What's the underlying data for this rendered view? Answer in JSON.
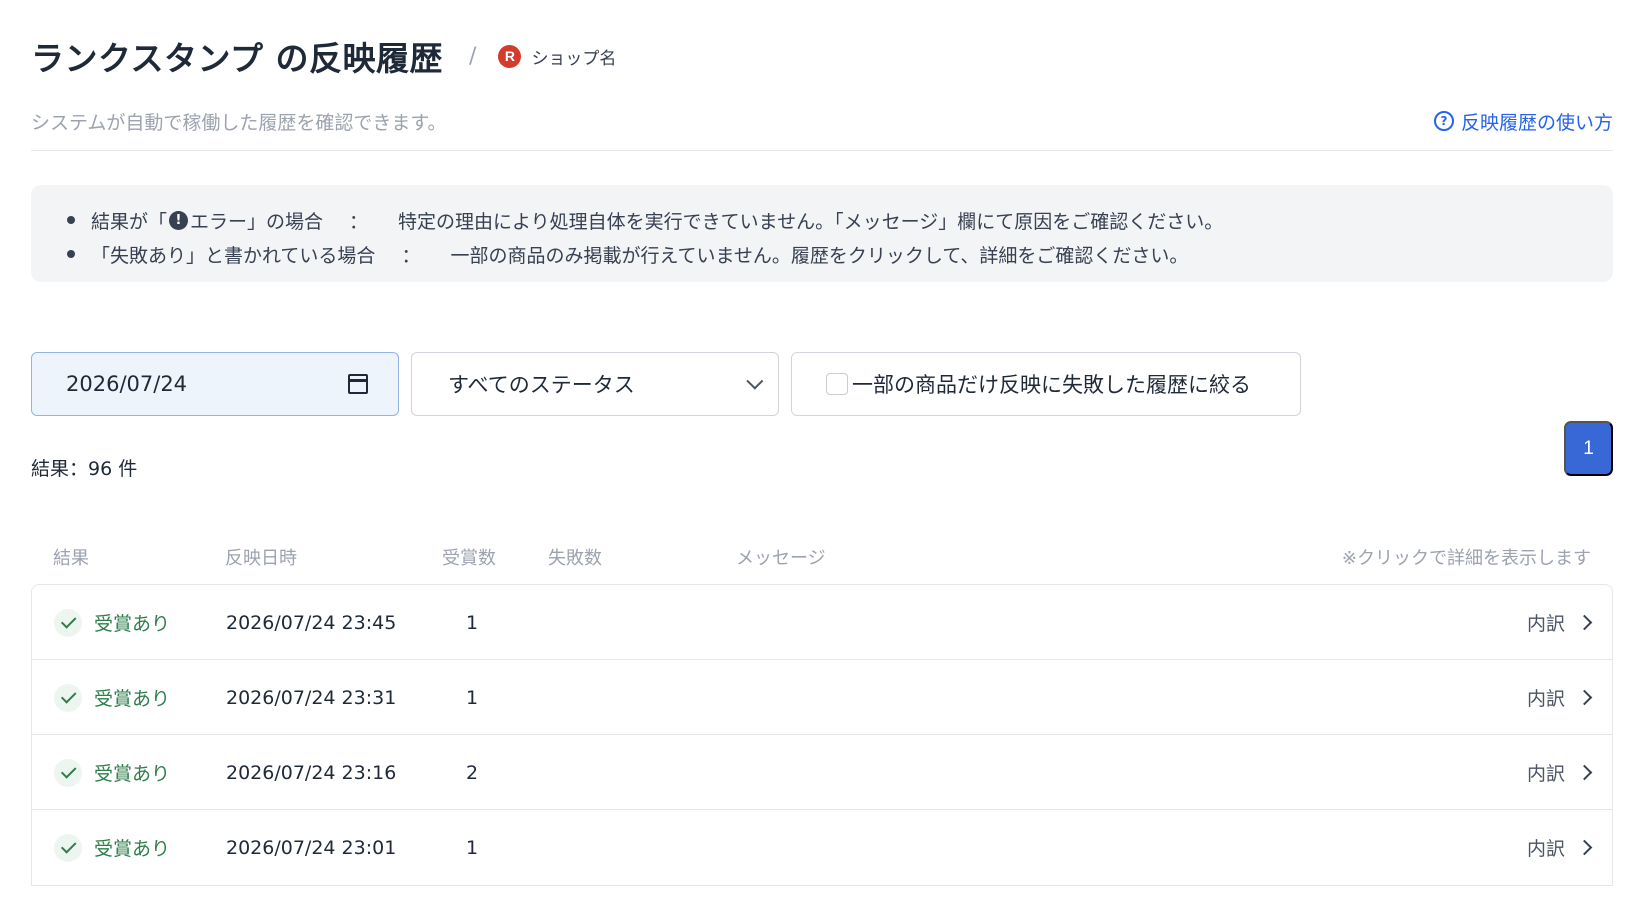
{
  "header": {
    "title": "ランクスタンプ の反映履歴",
    "separator": "/",
    "shop_badge": "R",
    "shop_name": "ショップ名"
  },
  "subheader": {
    "subtitle": "システムが自動で稼働した履歴を確認できます。",
    "help_icon": "?",
    "help_link": "反映履歴の使い方"
  },
  "notice": {
    "items": [
      {
        "cond_prefix": "結果が「",
        "icon": "!",
        "cond_suffix": " エラー」の場合",
        "colon": "：",
        "text": "特定の理由により処理自体を実行できていません。「メッセージ」欄にて原因をご確認ください。"
      },
      {
        "cond": "「失敗あり」と書かれている場合",
        "colon": "：",
        "text": "一部の商品のみ掲載が行えていません。履歴をクリックして、詳細をご確認ください。"
      }
    ]
  },
  "filters": {
    "date_value": "2026/07/24",
    "status_selected": "すべてのステータス",
    "partial_failure_label": "一部の商品だけ反映に失敗した履歴に絞る"
  },
  "results": {
    "count_label": "結果：96 件",
    "page_current": "1"
  },
  "table": {
    "headers": {
      "result": "結果",
      "datetime": "反映日時",
      "awards": "受賞数",
      "failures": "失敗数",
      "message": "メッセージ",
      "hint": "※クリックで詳細を表示します"
    },
    "detail_label": "内訳",
    "rows": [
      {
        "status": "受賞あり",
        "datetime": "2026/07/24 23:45",
        "awards": "1"
      },
      {
        "status": "受賞あり",
        "datetime": "2026/07/24 23:31",
        "awards": "1"
      },
      {
        "status": "受賞あり",
        "datetime": "2026/07/24 23:16",
        "awards": "2"
      },
      {
        "status": "受賞あり",
        "datetime": "2026/07/24 23:01",
        "awards": "1"
      }
    ]
  },
  "colors": {
    "accent": "#2563eb",
    "page_button": "#3867d6",
    "success": "#2e7d4a",
    "shop_badge": "#d33b2c"
  }
}
